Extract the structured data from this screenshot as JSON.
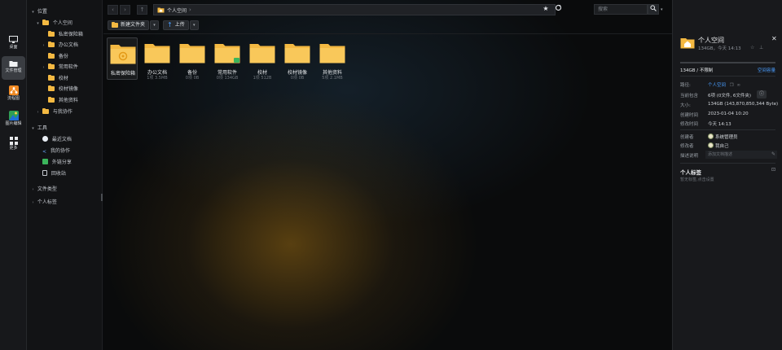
{
  "dock": {
    "items": [
      {
        "label": "桌面",
        "icon": "monitor-icon"
      },
      {
        "label": "文件管理",
        "icon": "folder-icon"
      },
      {
        "label": "流程图",
        "icon": "flowchart-icon"
      },
      {
        "label": "图片编辑",
        "icon": "image-editor-icon"
      },
      {
        "label": "更多",
        "icon": "grid-more-icon"
      }
    ]
  },
  "tree": {
    "location_title": "位置",
    "personal_space": "个人空间",
    "children": [
      "私密保险箱",
      "办公文档",
      "备份",
      "常用软件",
      "校材",
      "校材镜像",
      "其他资料"
    ],
    "shared": "与我协作",
    "tools_title": "工具",
    "tools": [
      "最近文档",
      "我的协作",
      "外链分享",
      "回收站"
    ],
    "file_types": "文件类型",
    "personal_tags": "个人标签"
  },
  "addressbar": {
    "path": "个人空间",
    "search_placeholder": "搜索"
  },
  "toolbar": {
    "new_folder": "新建文件夹",
    "upload": "上传"
  },
  "files": [
    {
      "name": "私密保险箱",
      "meta": "",
      "special": "vault"
    },
    {
      "name": "办公文档",
      "meta": "1项 3.5MB"
    },
    {
      "name": "备份",
      "meta": "0项 0B"
    },
    {
      "name": "常用软件",
      "meta": "0项 134GB",
      "badge": true
    },
    {
      "name": "校材",
      "meta": "1项 512B"
    },
    {
      "name": "校材镜像",
      "meta": "0项 0B"
    },
    {
      "name": "其他资料",
      "meta": "5项 2.1MB"
    }
  ],
  "panel": {
    "title": "个人空间",
    "subtitle": "134GB，今天 14:13",
    "usage": "134GB / 不限制",
    "space_link": "空间容量",
    "rows": [
      {
        "key": "路径:",
        "value": "个人空间"
      },
      {
        "key": "当前包含",
        "value": "6项 (0文件, 6文件夹)"
      },
      {
        "key": "大小:",
        "value": "134GB (143,870,850,344 Byte)"
      },
      {
        "key": "创建时间",
        "value": "2023-01-04 10:20"
      },
      {
        "key": "修改时间",
        "value": "今天 14:13"
      }
    ],
    "creator_key": "创建者",
    "creator": "系统管理员",
    "modifier_key": "修改者",
    "modifier": "我自己",
    "desc_key": "描述说明",
    "desc_placeholder": "添加文档描述",
    "tags_title": "个人标签",
    "tags_hint": "暂无标签,点击设置"
  },
  "colors": {
    "folder": "#f4b942",
    "accent": "#4a9eff"
  }
}
